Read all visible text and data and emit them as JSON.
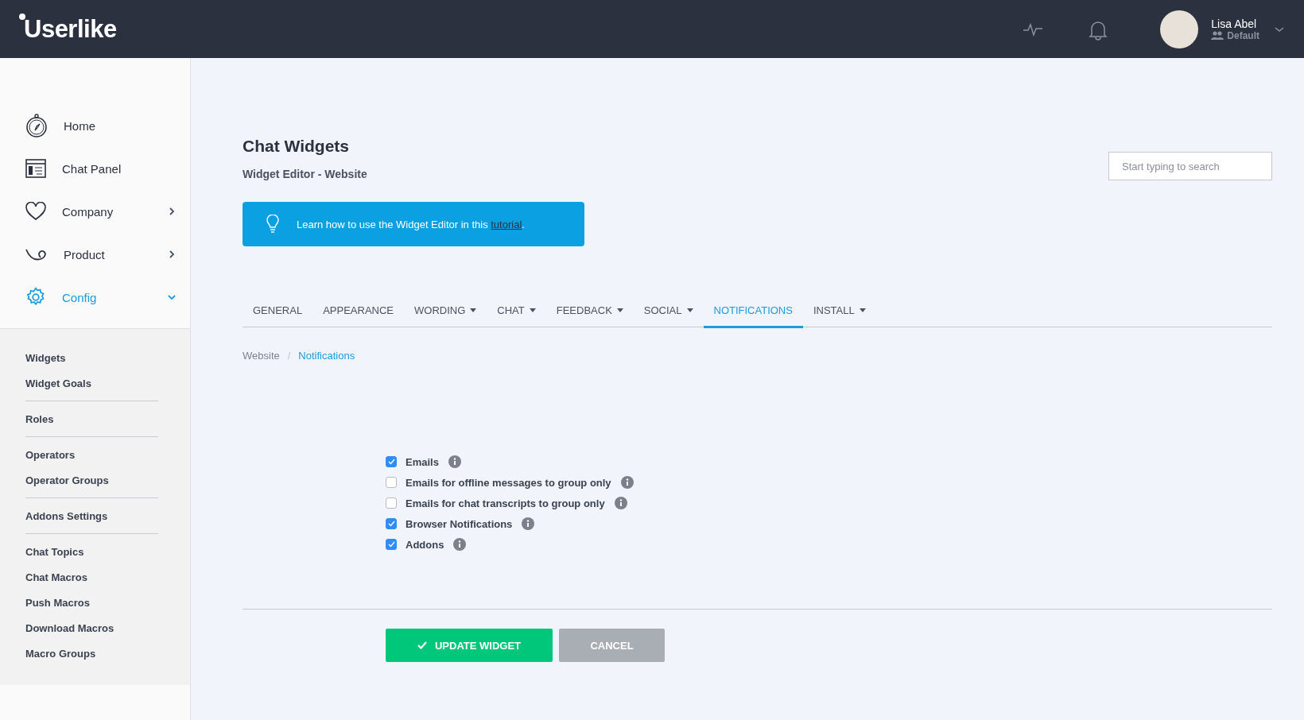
{
  "header": {
    "logo": "Userlike",
    "user": {
      "name": "Lisa Abel",
      "role": "Default"
    }
  },
  "sidebar": {
    "items": [
      {
        "label": "Home",
        "selected": false
      },
      {
        "label": "Chat Panel",
        "selected": false
      },
      {
        "label": "Company",
        "expanded": false,
        "selected": false
      },
      {
        "label": "Product",
        "expanded": false,
        "selected": false
      },
      {
        "label": "Config",
        "expanded": true,
        "selected": true
      }
    ],
    "submenu_groups": [
      [
        "Widgets",
        "Widget Goals"
      ],
      [
        "Roles"
      ],
      [
        "Operators",
        "Operator Groups"
      ],
      [
        "Addons Settings"
      ],
      [
        "Chat Topics",
        "Chat Macros",
        "Push Macros",
        "Download Macros",
        "Macro Groups"
      ]
    ]
  },
  "page": {
    "title": "Chat Widgets",
    "subtitle": "Widget Editor - Website",
    "search": {
      "placeholder": "Start typing to search"
    },
    "tip": {
      "text": "Learn how to use the Widget Editor in this ",
      "link": "tutorial",
      "text_after": "."
    }
  },
  "tabs": [
    {
      "label": "GENERAL",
      "has_menu": false,
      "selected": false
    },
    {
      "label": "APPEARANCE",
      "has_menu": false,
      "selected": false
    },
    {
      "label": "WORDING",
      "has_menu": true,
      "selected": false
    },
    {
      "label": "CHAT",
      "has_menu": true,
      "selected": false
    },
    {
      "label": "FEEDBACK",
      "has_menu": true,
      "selected": false
    },
    {
      "label": "SOCIAL",
      "has_menu": true,
      "selected": false
    },
    {
      "label": "NOTIFICATIONS",
      "has_menu": false,
      "selected": true
    },
    {
      "label": "INSTALL",
      "has_menu": true,
      "selected": false
    }
  ],
  "breadcrumb_separator": "/",
  "breadcrumb": [
    {
      "label": "Website",
      "selected": false
    },
    {
      "label": "Notifications",
      "selected": true
    }
  ],
  "options": [
    {
      "label": "Emails",
      "checked": true
    },
    {
      "label": "Emails for offline messages to group only",
      "checked": false
    },
    {
      "label": "Emails for chat transcripts to group only",
      "checked": false
    },
    {
      "label": "Browser Notifications",
      "checked": true
    },
    {
      "label": "Addons",
      "checked": true
    }
  ],
  "buttons": [
    {
      "label": "UPDATE WIDGET",
      "kind": "primary"
    },
    {
      "label": "CANCEL",
      "kind": "secondary"
    }
  ]
}
